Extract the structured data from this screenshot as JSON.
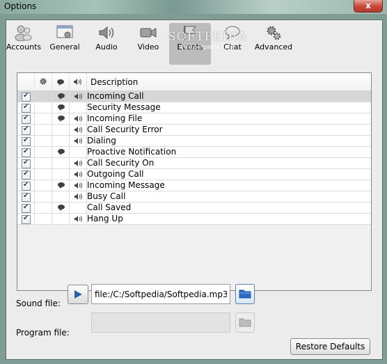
{
  "window": {
    "title": "Options",
    "close_glyph": "x"
  },
  "watermark": {
    "text": "SOFTPEDIA",
    "url": "www.softpedia.com"
  },
  "tabs": [
    {
      "label": "Accounts",
      "icon": "accounts-icon"
    },
    {
      "label": "General",
      "icon": "general-icon"
    },
    {
      "label": "Audio",
      "icon": "audio-icon"
    },
    {
      "label": "Video",
      "icon": "video-icon"
    },
    {
      "label": "Events",
      "icon": "events-icon",
      "active": true
    },
    {
      "label": "Chat",
      "icon": "chat-icon"
    },
    {
      "label": "Advanced",
      "icon": "advanced-icon"
    }
  ],
  "events_table": {
    "columns": [
      "enabled",
      "program-icon",
      "popup-icon",
      "sound-icon",
      "Description"
    ],
    "description_header": "Description",
    "rows": [
      {
        "enabled": true,
        "popup": true,
        "sound": true,
        "description": "Incoming Call",
        "selected": true
      },
      {
        "enabled": true,
        "popup": true,
        "sound": false,
        "description": "Security Message"
      },
      {
        "enabled": true,
        "popup": true,
        "sound": true,
        "description": "Incoming File"
      },
      {
        "enabled": true,
        "popup": false,
        "sound": true,
        "description": "Call Security Error"
      },
      {
        "enabled": true,
        "popup": false,
        "sound": true,
        "description": "Dialing"
      },
      {
        "enabled": true,
        "popup": true,
        "sound": false,
        "description": "Proactive Notification"
      },
      {
        "enabled": true,
        "popup": false,
        "sound": true,
        "description": "Call Security On"
      },
      {
        "enabled": true,
        "popup": false,
        "sound": true,
        "description": "Outgoing Call"
      },
      {
        "enabled": true,
        "popup": true,
        "sound": true,
        "description": "Incoming Message"
      },
      {
        "enabled": true,
        "popup": false,
        "sound": true,
        "description": "Busy Call"
      },
      {
        "enabled": true,
        "popup": true,
        "sound": false,
        "description": "Call Saved"
      },
      {
        "enabled": true,
        "popup": false,
        "sound": true,
        "description": "Hang Up"
      }
    ]
  },
  "sound_file": {
    "label": "Sound file:",
    "value": "file:/C:/Softpedia/Softpedia.mp3"
  },
  "program_file": {
    "label": "Program file:",
    "value": ""
  },
  "buttons": {
    "restore_defaults": "Restore Defaults"
  },
  "colors": {
    "selection": "#d6d6d6",
    "play_icon": "#2f5ea8",
    "folder": "#2d6bc4"
  }
}
